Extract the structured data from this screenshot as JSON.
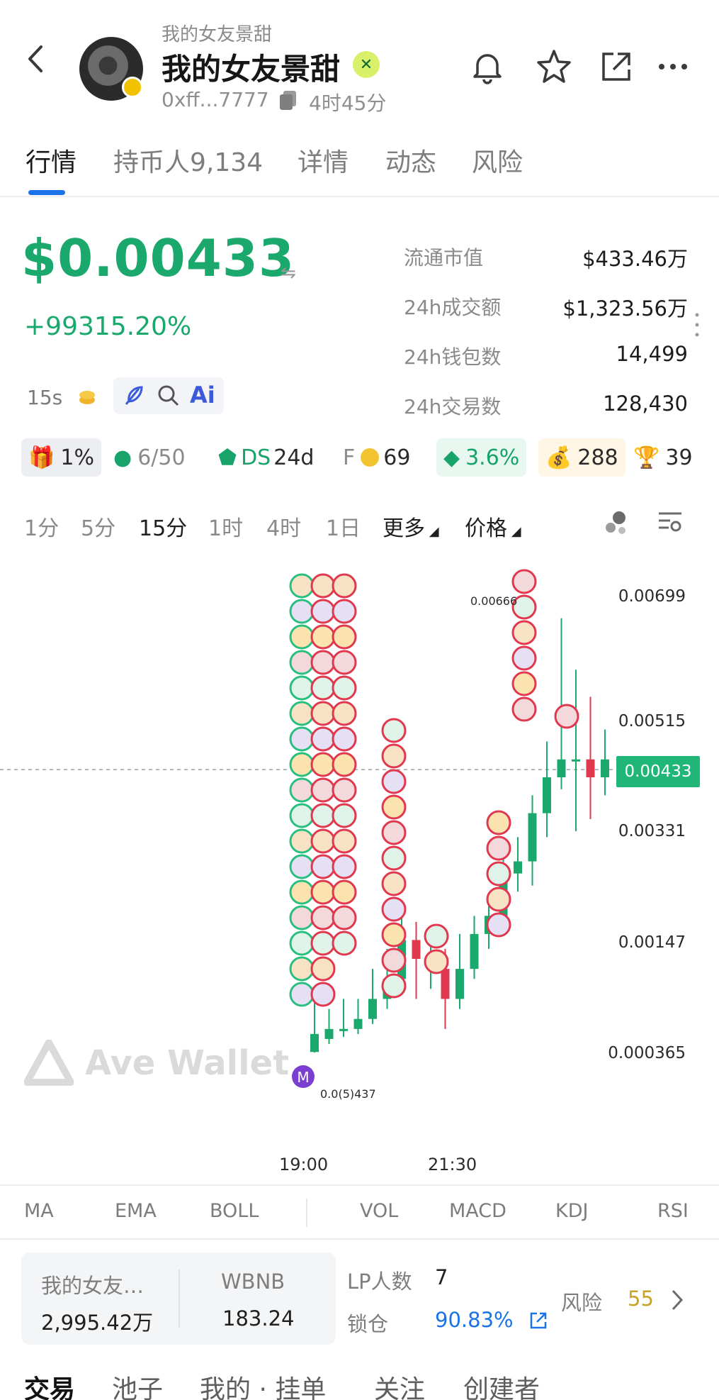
{
  "header": {
    "subname": "我的女友景甜",
    "title": "我的女友景甜",
    "address": "0xff...7777",
    "age": "4时45分"
  },
  "tabs": [
    {
      "label": "行情",
      "active": true
    },
    {
      "label": "持币人9,134",
      "active": false
    },
    {
      "label": "详情",
      "active": false
    },
    {
      "label": "动态",
      "active": false
    },
    {
      "label": "风险",
      "active": false
    }
  ],
  "price": {
    "value": "$0.00433",
    "change": "+99315.20%",
    "swap_symbol": "⇋"
  },
  "stats": [
    {
      "label": "流通市值",
      "value": "$433.46万"
    },
    {
      "label": "24h成交额",
      "value": "$1,323.56万"
    },
    {
      "label": "24h钱包数",
      "value": "14,499"
    },
    {
      "label": "24h交易数",
      "value": "128,430"
    }
  ],
  "tools": {
    "timeframe": "15s",
    "ai": "Ai"
  },
  "badges": [
    {
      "text": "1%",
      "icon": "gift-icon",
      "bg": "#eceef2",
      "color": "#2a2a2a"
    },
    {
      "text": "6/50",
      "icon": "holder-icon",
      "bg": "#ffffff",
      "color": "#8a8a8a"
    },
    {
      "text": "DS",
      "text2": "24d",
      "icon": "ds-icon",
      "bg": "#ffffff",
      "color": "#18a36a"
    },
    {
      "text": "F",
      "text2": "69",
      "icon": "coin-icon",
      "bg": "#ffffff",
      "color": "#8a8a8a"
    },
    {
      "text": "3.6%",
      "icon": "layers-icon",
      "bg": "#e8f8f0",
      "color": "#18a36a"
    },
    {
      "text": "288",
      "icon": "money-bag-icon",
      "bg": "#fff6e6",
      "color": "#2a2a2a"
    },
    {
      "text": "39",
      "icon": "trophy-icon",
      "bg": "#ffffff",
      "color": "#2a2a2a"
    }
  ],
  "intervals": [
    "1分",
    "5分",
    "15分",
    "1时",
    "4时",
    "1日"
  ],
  "selected_interval": "15分",
  "more_label": "更多",
  "price_label": "价格",
  "chart_data": {
    "type": "candlestick",
    "y_ticks": [
      "0.00699",
      "0.00515",
      "0.00331",
      "0.00147",
      "0.000365"
    ],
    "x_ticks": [
      "19:00",
      "21:30"
    ],
    "current_price_label": "0.00433",
    "high_annotation": "0.00666",
    "low_annotation": "0.0(5)437",
    "candles": [
      {
        "o": 0.00037,
        "c": 0.00055,
        "h": 0.0009,
        "l": 0.00036
      },
      {
        "o": 0.0005,
        "c": 0.0006,
        "h": 0.0008,
        "l": 0.00045
      },
      {
        "o": 0.00058,
        "c": 0.0006,
        "h": 0.0009,
        "l": 0.00052
      },
      {
        "o": 0.0006,
        "c": 0.0007,
        "h": 0.0009,
        "l": 0.00055
      },
      {
        "o": 0.0007,
        "c": 0.0009,
        "h": 0.0012,
        "l": 0.00065
      },
      {
        "o": 0.0009,
        "c": 0.0011,
        "h": 0.0014,
        "l": 0.0008
      },
      {
        "o": 0.0011,
        "c": 0.0015,
        "h": 0.0019,
        "l": 0.001
      },
      {
        "o": 0.0015,
        "c": 0.0013,
        "h": 0.0018,
        "l": 0.0009
      },
      {
        "o": 0.0013,
        "c": 0.0013,
        "h": 0.0017,
        "l": 0.001
      },
      {
        "o": 0.0012,
        "c": 0.0009,
        "h": 0.0014,
        "l": 0.0006
      },
      {
        "o": 0.0009,
        "c": 0.0012,
        "h": 0.0016,
        "l": 0.0008
      },
      {
        "o": 0.0012,
        "c": 0.0016,
        "h": 0.0019,
        "l": 0.0011
      },
      {
        "o": 0.0016,
        "c": 0.0019,
        "h": 0.0022,
        "l": 0.0014
      },
      {
        "o": 0.0019,
        "c": 0.0026,
        "h": 0.0029,
        "l": 0.0017
      },
      {
        "o": 0.0026,
        "c": 0.0028,
        "h": 0.0032,
        "l": 0.0023
      },
      {
        "o": 0.0028,
        "c": 0.0036,
        "h": 0.0039,
        "l": 0.0024
      },
      {
        "o": 0.0036,
        "c": 0.0042,
        "h": 0.0048,
        "l": 0.0032
      },
      {
        "o": 0.0042,
        "c": 0.0045,
        "h": 0.00666,
        "l": 0.004
      },
      {
        "o": 0.0045,
        "c": 0.0045,
        "h": 0.0059,
        "l": 0.0033
      },
      {
        "o": 0.0045,
        "c": 0.0042,
        "h": 0.0055,
        "l": 0.0035
      },
      {
        "o": 0.0042,
        "c": 0.0045,
        "h": 0.005,
        "l": 0.0039
      }
    ]
  },
  "indicators": [
    "MA",
    "EMA",
    "BOLL",
    "VOL",
    "MACD",
    "KDJ",
    "RSI"
  ],
  "pool": {
    "token_label": "我的女友…",
    "token_value": "2,995.42万",
    "base_label": "WBNB",
    "base_value": "183.24",
    "lp_label": "LP人数",
    "lp_value": "7",
    "lock_label": "锁仓",
    "lock_value": "90.83%",
    "risk_label": "风险",
    "risk_value": "55"
  },
  "bottom_tabs": [
    "交易",
    "池子",
    "我的 · 挂单",
    "关注",
    "创建者"
  ],
  "watermark": "Ave Wallet",
  "colors": {
    "green": "#1aa86c",
    "red": "#e0394f",
    "blue": "#1a73e8",
    "risk": "#c9a227"
  }
}
